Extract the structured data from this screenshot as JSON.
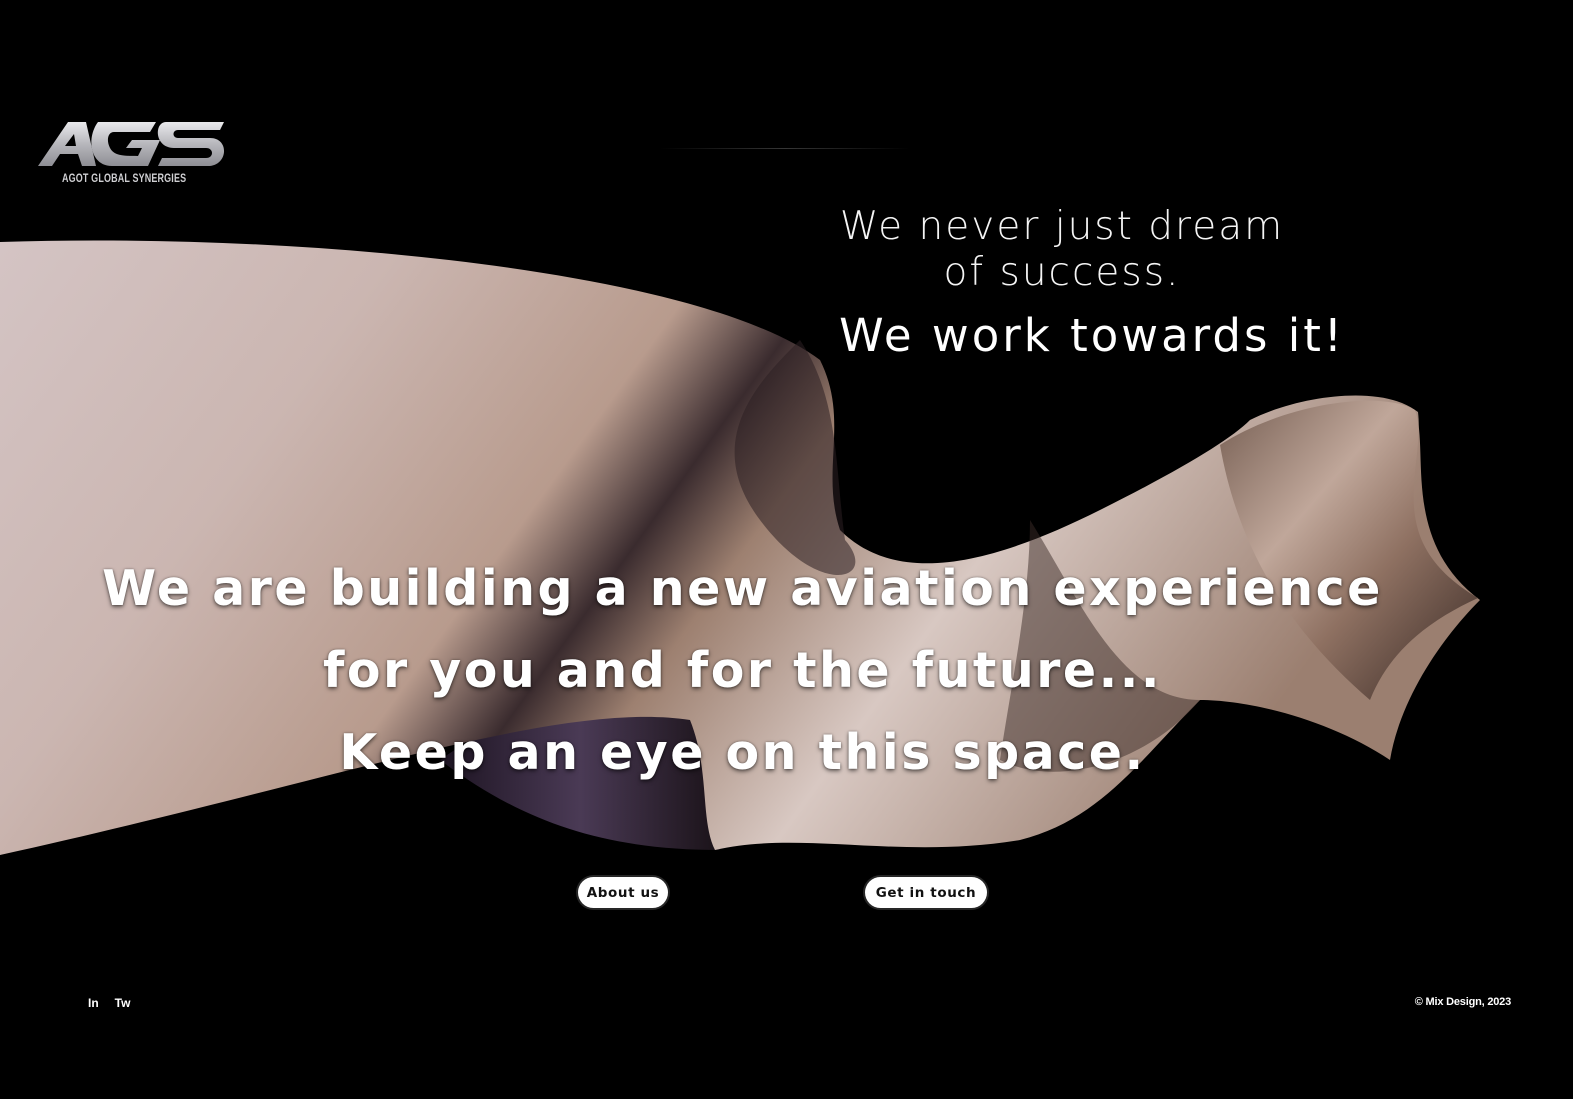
{
  "brand": {
    "logo_text": "AGS",
    "logo_subtitle": "AGOT GLOBAL SYNERGIES"
  },
  "tagline": {
    "line1": "We never just dream",
    "line2": "of success.",
    "line3": "We work towards it!"
  },
  "headline": {
    "line1": "We are building a new aviation experience",
    "line2": "for you and for the future...",
    "line3": "Keep an eye on this space."
  },
  "buttons": {
    "about_label": "About us",
    "contact_label": "Get in touch"
  },
  "footer": {
    "social": [
      {
        "label": "In",
        "icon": "linkedin-link"
      },
      {
        "label": "Tw",
        "icon": "twitter-link"
      }
    ],
    "copyright": "© Mix Design, 2023"
  },
  "colors": {
    "background": "#000000",
    "ribbon_light": "#d9ccca",
    "ribbon_mid": "#8d7468",
    "ribbon_shadow": "#2a1f2e",
    "button_bg": "#ffffff",
    "button_text": "#111111"
  }
}
